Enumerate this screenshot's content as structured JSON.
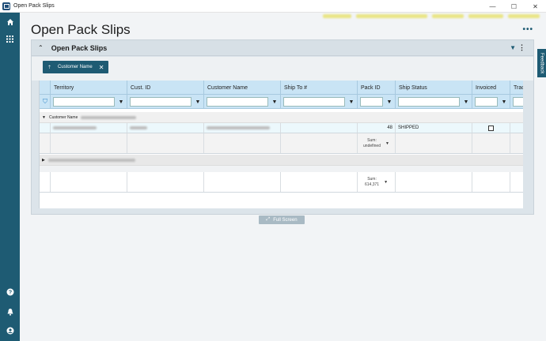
{
  "window": {
    "title": "Open Pack Slips",
    "minimize_glyph": "—",
    "maximize_glyph": "☐",
    "close_glyph": "✕"
  },
  "sidebar": {
    "top_icons": [
      "home-icon",
      "apps-grid-icon"
    ],
    "bottom_icons": [
      "help-icon",
      "notifications-icon",
      "user-account-icon"
    ]
  },
  "page": {
    "title": "Open Pack Slips"
  },
  "panel": {
    "title": "Open Pack Slips",
    "full_screen_label": "Full Screen"
  },
  "group_chip": {
    "label": "Customer Name",
    "remove_glyph": "✕"
  },
  "grid": {
    "columns": [
      "Territory",
      "Cust. ID",
      "Customer Name",
      "Ship To #",
      "Pack ID",
      "Ship Status",
      "Invoiced",
      "Trackin"
    ],
    "group_label": "Customer Name",
    "row": {
      "pack_id": "48",
      "ship_status": "SHIPPED"
    },
    "group_sum": {
      "label": "Sum:",
      "value": "undefined"
    },
    "total_sum": {
      "label": "Sum:",
      "value": "614,371"
    }
  },
  "feedback": {
    "label": "Feedback"
  },
  "colors": {
    "sidebar": "#1e5b73",
    "header_blue": "#c9e4f5",
    "accent": "#1e5b73"
  }
}
